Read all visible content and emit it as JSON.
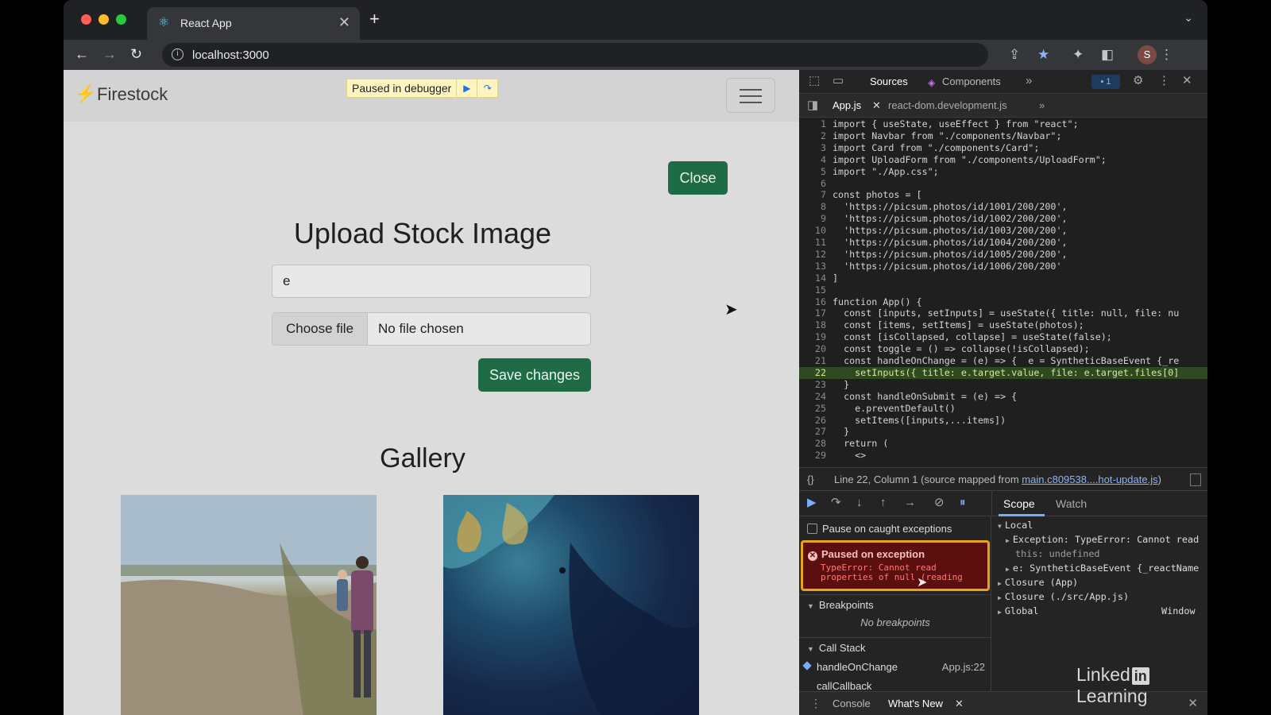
{
  "browser": {
    "tab_title": "React App",
    "tab_close": "✕",
    "new_tab": "+",
    "url": "localhost:3000",
    "profile_initial": "S"
  },
  "page": {
    "brand": "Firestock",
    "debugger_badge": "Paused in debugger",
    "close_label": "Close",
    "form_title": "Upload Stock Image",
    "title_input_value": "e",
    "choose_file_label": "Choose file",
    "no_file_label": "No file chosen",
    "save_label": "Save changes",
    "gallery_title": "Gallery"
  },
  "devtools": {
    "tabs": [
      "Sources",
      "Components"
    ],
    "issues_count": "1",
    "file_tabs": [
      "App.js",
      "react-dom.development.js"
    ],
    "code": [
      {
        "n": "1",
        "t": "import { useState, useEffect } from \"react\";"
      },
      {
        "n": "2",
        "t": "import Navbar from \"./components/Navbar\";"
      },
      {
        "n": "3",
        "t": "import Card from \"./components/Card\";"
      },
      {
        "n": "4",
        "t": "import UploadForm from \"./components/UploadForm\";"
      },
      {
        "n": "5",
        "t": "import \"./App.css\";"
      },
      {
        "n": "6",
        "t": ""
      },
      {
        "n": "7",
        "t": "const photos = ["
      },
      {
        "n": "8",
        "t": "  'https://picsum.photos/id/1001/200/200',"
      },
      {
        "n": "9",
        "t": "  'https://picsum.photos/id/1002/200/200',"
      },
      {
        "n": "10",
        "t": "  'https://picsum.photos/id/1003/200/200',"
      },
      {
        "n": "11",
        "t": "  'https://picsum.photos/id/1004/200/200',"
      },
      {
        "n": "12",
        "t": "  'https://picsum.photos/id/1005/200/200',"
      },
      {
        "n": "13",
        "t": "  'https://picsum.photos/id/1006/200/200'"
      },
      {
        "n": "14",
        "t": "]"
      },
      {
        "n": "15",
        "t": ""
      },
      {
        "n": "16",
        "t": "function App() {"
      },
      {
        "n": "17",
        "t": "  const [inputs, setInputs] = useState({ title: null, file: nu"
      },
      {
        "n": "18",
        "t": "  const [items, setItems] = useState(photos);"
      },
      {
        "n": "19",
        "t": "  const [isCollapsed, collapse] = useState(false);"
      },
      {
        "n": "20",
        "t": "  const toggle = () => collapse(!isCollapsed);"
      },
      {
        "n": "21",
        "t": "  const handleOnChange = (e) => {  e = SyntheticBaseEvent {_re"
      },
      {
        "n": "22",
        "t": "    setInputs({ title: e.target.value, file: e.target.files[0]"
      },
      {
        "n": "23",
        "t": "  }"
      },
      {
        "n": "24",
        "t": "  const handleOnSubmit = (e) => {"
      },
      {
        "n": "25",
        "t": "    e.preventDefault()"
      },
      {
        "n": "26",
        "t": "    setItems([inputs,...items])"
      },
      {
        "n": "27",
        "t": "  }"
      },
      {
        "n": "28",
        "t": "  return ("
      },
      {
        "n": "29",
        "t": "    <>"
      }
    ],
    "status_prefix": "Line 22, Column 1  (source mapped from ",
    "status_link": "main.c809538....hot-update.js",
    "status_suffix": ")",
    "pause_caught": "Pause on caught exceptions",
    "exception_title": "Paused on exception",
    "exception_msg_1": "TypeError: Cannot read",
    "exception_msg_2": "properties of null (reading",
    "breakpoints_hdr": "Breakpoints",
    "no_breakpoints": "No breakpoints",
    "callstack_hdr": "Call Stack",
    "stack": [
      {
        "name": "handleOnChange",
        "loc": "App.js:22"
      },
      {
        "name": "callCallback",
        "loc": ""
      }
    ],
    "scope_tabs": [
      "Scope",
      "Watch"
    ],
    "scope": {
      "local": "Local",
      "exception": "Exception: TypeError: Cannot read",
      "this_line": "this: undefined",
      "e_line": "e: SyntheticBaseEvent {_reactName",
      "closure_app": "Closure (App)",
      "closure_file": "Closure (./src/App.js)",
      "global": "Global",
      "global_val": "Window"
    },
    "drawer_tabs": [
      "Console",
      "What's New"
    ]
  },
  "watermark": {
    "left": "Linked",
    "badge": "in",
    "right": "Learning"
  }
}
